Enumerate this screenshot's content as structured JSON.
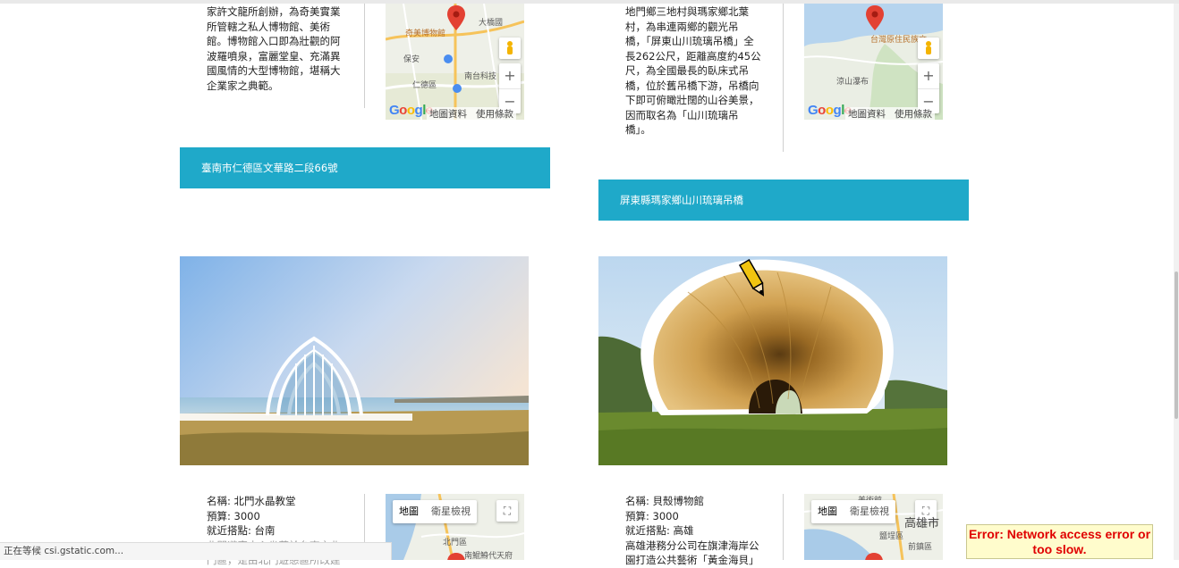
{
  "top_left": {
    "description": "家許文龍所創辦，為奇美實業\n所管轄之私人博物館、美術\n館。博物館入口即為壯觀的阿\n波羅噴泉，富麗堂皇、充滿異\n國風情的大型博物館，堪稱大\n企業家之典範。",
    "map": {
      "place_label": "奇美博物館",
      "labels": [
        "大橋國",
        "保安",
        "南台科技",
        "仁德區"
      ],
      "zoom_in": "+",
      "zoom_out": "−",
      "footer_data": "地圖資料",
      "footer_terms": "使用條款"
    },
    "address_bar": "臺南市仁德區文華路二段66號"
  },
  "top_right": {
    "description": "地門鄉三地村與瑪家鄉北葉\n村，為串連兩鄉的觀光吊\n橋，「屏東山川琉璃吊橋」全\n長262公尺，距離高度約45公\n尺，為全國最長的臥床式吊\n橋，位於舊吊橋下游，吊橋向\n下即可俯瞰壯闊的山谷美景，\n因而取名為「山川琉璃吊\n橋」。",
    "map": {
      "place_label": "台灣原住民族文",
      "labels": [
        "涼山瀑布"
      ],
      "zoom_in": "+",
      "zoom_out": "−",
      "footer_data": "地圖資料",
      "footer_terms": "使用條款"
    },
    "address_bar": "屏東縣瑪家鄉山川琉璃吊橋"
  },
  "google_logo": [
    "G",
    "o",
    "o",
    "g",
    "l",
    "e"
  ],
  "bottom_left": {
    "photo_subject": "北門水晶教堂",
    "name_line": "名稱: 北門水晶教堂",
    "budget_line": "預算: 3000",
    "nearby_line": "就近搭點: 台南",
    "desc_start": "北門遊客中心坐落於台南市北",
    "desc_cut": "門區，是由北門遊憩區所改建",
    "map": {
      "map_btn": "地圖",
      "sat_btn": "衛星檢視",
      "labels": [
        "北門區",
        "南鯤鯓代天府"
      ],
      "fullscreen": "⛶"
    }
  },
  "bottom_right": {
    "photo_subject": "貝殼博物館",
    "name_line": "名稱: 貝殼博物館",
    "budget_line": "預算: 3000",
    "nearby_line": "就近搭點: 高雄",
    "desc_start": "高雄港務分公司在旗津海岸公",
    "desc_cut": "園打造公共藝術「黃金海貝」",
    "map": {
      "map_btn": "地圖",
      "sat_btn": "衛星檢視",
      "labels": [
        "美術館",
        "高雄市",
        "鹽埕區",
        "前鎮區"
      ],
      "fullscreen": "⛶"
    }
  },
  "status_bar": "正在等候 csi.gstatic.com...",
  "error_message": "Error: Network access error or too slow.",
  "colors": {
    "accent_bar": "#1fa9c9",
    "error_text": "#e00000",
    "error_bg": "#fffccc"
  }
}
